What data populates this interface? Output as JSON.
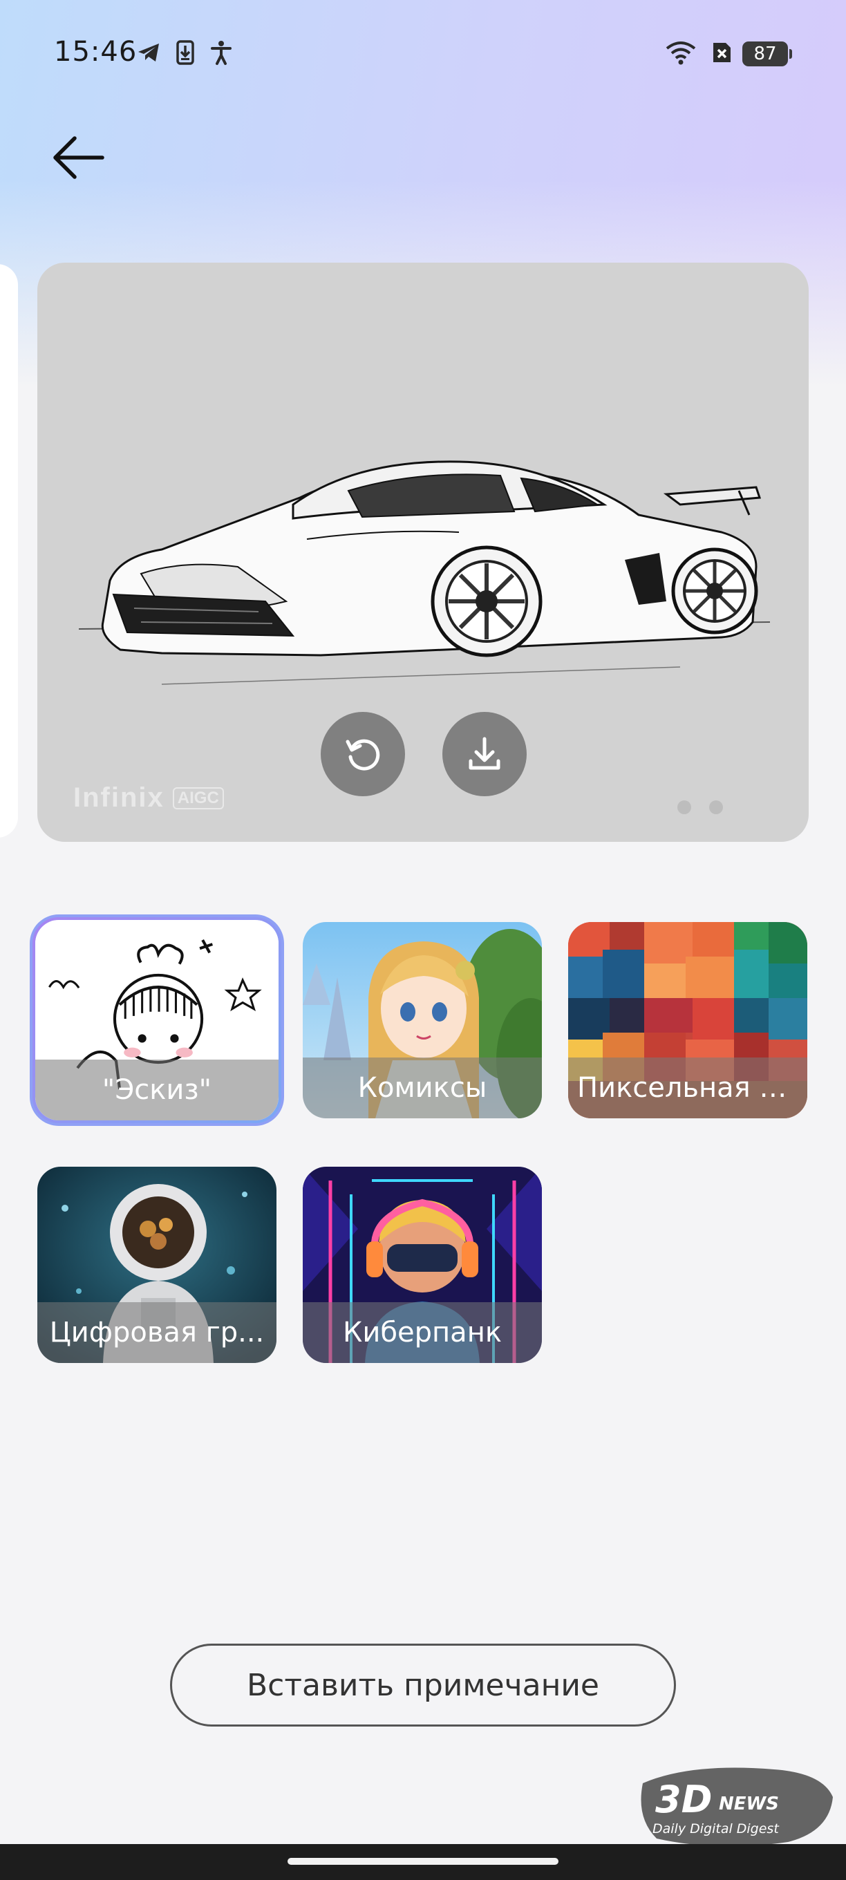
{
  "status_bar": {
    "time": "15:46",
    "battery": "87",
    "icons": [
      "telegram-icon",
      "download-notification-icon",
      "accessibility-icon",
      "wifi-icon",
      "sim-off-icon",
      "battery-icon"
    ]
  },
  "header": {
    "back_icon": "arrow-left-icon"
  },
  "preview": {
    "image": "car-sketch-image",
    "watermark_brand": "Infinix",
    "watermark_tag": "AIGC",
    "actions": [
      "refresh-icon",
      "download-icon"
    ],
    "page_count": 2
  },
  "styles": [
    {
      "label": "\"Эскиз\"",
      "selected": true
    },
    {
      "label": "Комиксы",
      "selected": false
    },
    {
      "label": "Пиксельная г...",
      "selected": false
    },
    {
      "label": "Цифровая гр...",
      "selected": false
    },
    {
      "label": "Киберпанк",
      "selected": false
    }
  ],
  "footer": {
    "insert_note_label": "Вставить примечание"
  },
  "site_badge": {
    "brand": "3DNEWS",
    "tagline": "Daily Digital Digest"
  },
  "colors": {
    "accent_ring": "#8fa0f5",
    "preview_bg": "#d2d2d2",
    "background": "#f4f4f6"
  }
}
